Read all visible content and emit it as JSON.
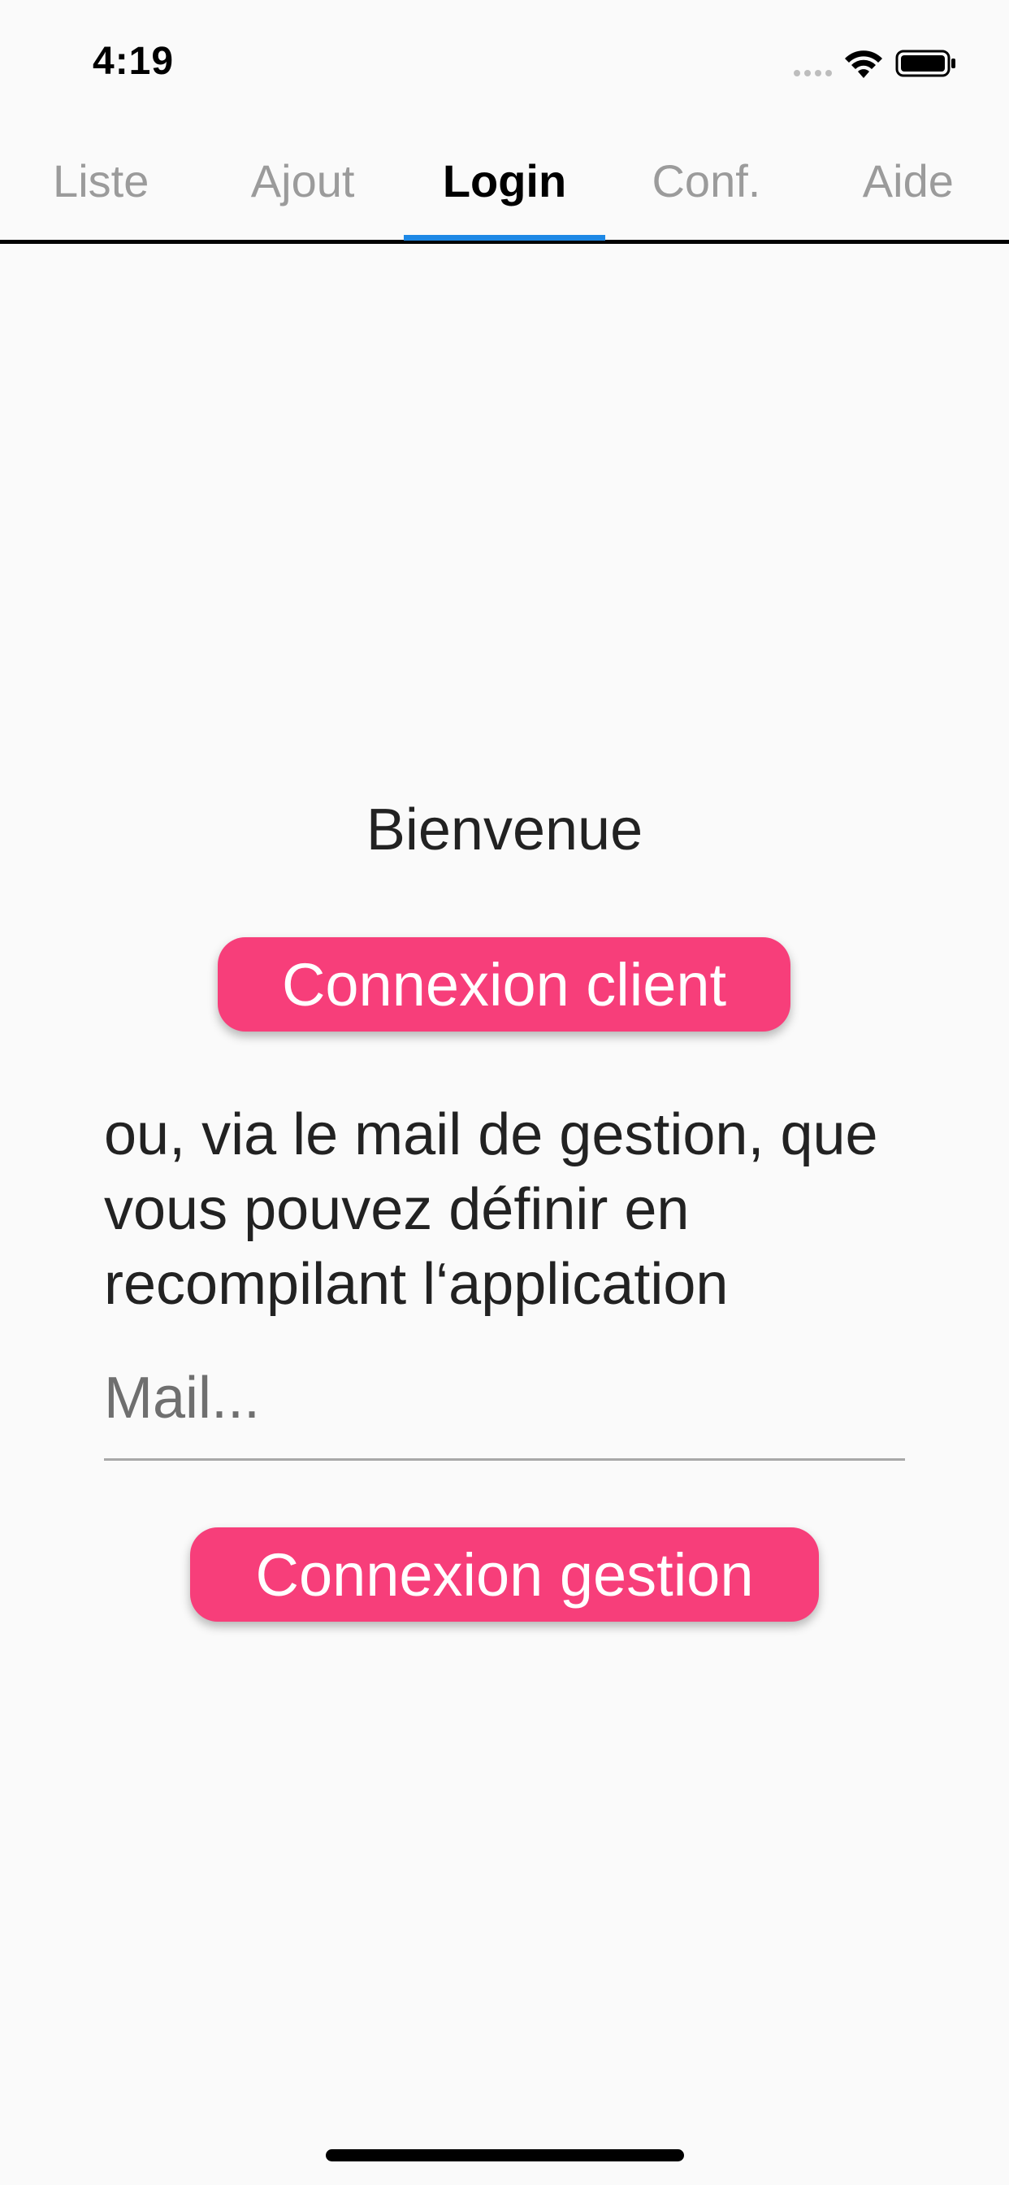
{
  "status_bar": {
    "time": "4:19",
    "icons": [
      "signal-icon",
      "wifi-icon",
      "battery-icon"
    ]
  },
  "tabs": [
    {
      "label": "Liste",
      "active": false
    },
    {
      "label": "Ajout",
      "active": false
    },
    {
      "label": "Login",
      "active": true
    },
    {
      "label": "Conf.",
      "active": false
    },
    {
      "label": "Aide",
      "active": false
    }
  ],
  "colors": {
    "accent_button": "#f73e7a",
    "tab_indicator": "#1e88e5",
    "background": "#fafafa"
  },
  "login": {
    "welcome": "Bienvenue",
    "client_button": "Connexion client",
    "info_text": "ou, via le mail de gestion, que vous pouvez définir en recompilant l‘application",
    "mail_placeholder": "Mail...",
    "mail_value": "",
    "gestion_button": "Connexion gestion"
  }
}
